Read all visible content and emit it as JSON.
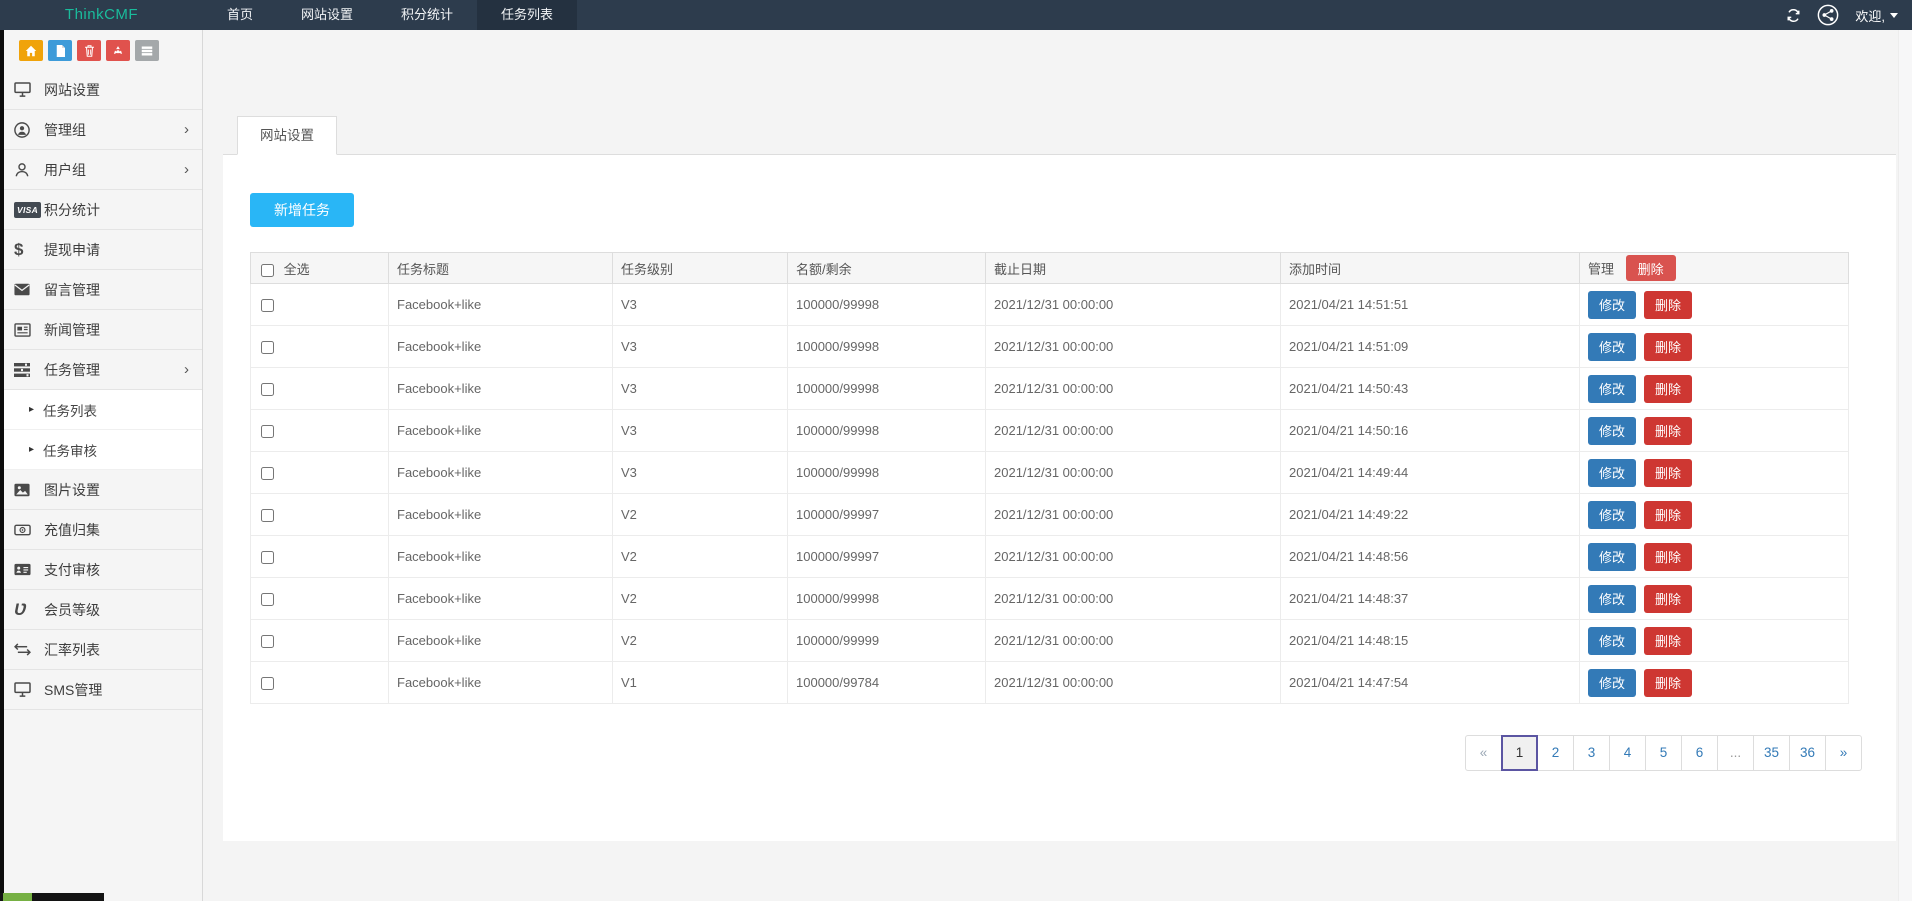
{
  "navbar": {
    "brand": "ThinkCMF",
    "items": [
      {
        "label": "首页",
        "active": false
      },
      {
        "label": "网站设置",
        "active": false
      },
      {
        "label": "积分统计",
        "active": false
      },
      {
        "label": "任务列表",
        "active": true
      }
    ],
    "welcome": "欢迎,"
  },
  "sidebar": {
    "quick_icons": [
      "home",
      "file",
      "trash",
      "recycle",
      "list"
    ],
    "items": [
      {
        "label": "网站设置"
      },
      {
        "label": "管理组"
      },
      {
        "label": "用户组"
      },
      {
        "label": "积分统计"
      },
      {
        "label": "提现申请"
      },
      {
        "label": "留言管理"
      },
      {
        "label": "新闻管理"
      },
      {
        "label": "任务管理"
      },
      {
        "label": "任务列表"
      },
      {
        "label": "任务审核"
      },
      {
        "label": "图片设置"
      },
      {
        "label": "充值归集"
      },
      {
        "label": "支付审核"
      },
      {
        "label": "会员等级"
      },
      {
        "label": "汇率列表"
      },
      {
        "label": "SMS管理"
      }
    ]
  },
  "glyphs": {
    "visa": "VISA",
    "dollar": "$",
    "vine": "Ʋ",
    "chevron": "›",
    "sub_arrow": "▸"
  },
  "main": {
    "tab": "网站设置",
    "add_button": "新增任务",
    "table": {
      "headers": {
        "select_all": "全选",
        "title": "任务标题",
        "level": "任务级别",
        "quota": "名额/剩余",
        "deadline": "截止日期",
        "added": "添加时间",
        "manage": "管理",
        "delete": "删除"
      },
      "edit_label": "修改",
      "delete_label": "删除",
      "rows": [
        {
          "title": "Facebook+like",
          "level": "V3",
          "quota": "100000/99998",
          "deadline": "2021/12/31 00:00:00",
          "added": "2021/04/21 14:51:51"
        },
        {
          "title": "Facebook+like",
          "level": "V3",
          "quota": "100000/99998",
          "deadline": "2021/12/31 00:00:00",
          "added": "2021/04/21 14:51:09"
        },
        {
          "title": "Facebook+like",
          "level": "V3",
          "quota": "100000/99998",
          "deadline": "2021/12/31 00:00:00",
          "added": "2021/04/21 14:50:43"
        },
        {
          "title": "Facebook+like",
          "level": "V3",
          "quota": "100000/99998",
          "deadline": "2021/12/31 00:00:00",
          "added": "2021/04/21 14:50:16"
        },
        {
          "title": "Facebook+like",
          "level": "V3",
          "quota": "100000/99998",
          "deadline": "2021/12/31 00:00:00",
          "added": "2021/04/21 14:49:44"
        },
        {
          "title": "Facebook+like",
          "level": "V2",
          "quota": "100000/99997",
          "deadline": "2021/12/31 00:00:00",
          "added": "2021/04/21 14:49:22"
        },
        {
          "title": "Facebook+like",
          "level": "V2",
          "quota": "100000/99997",
          "deadline": "2021/12/31 00:00:00",
          "added": "2021/04/21 14:48:56"
        },
        {
          "title": "Facebook+like",
          "level": "V2",
          "quota": "100000/99998",
          "deadline": "2021/12/31 00:00:00",
          "added": "2021/04/21 14:48:37"
        },
        {
          "title": "Facebook+like",
          "level": "V2",
          "quota": "100000/99999",
          "deadline": "2021/12/31 00:00:00",
          "added": "2021/04/21 14:48:15"
        },
        {
          "title": "Facebook+like",
          "level": "V1",
          "quota": "100000/99784",
          "deadline": "2021/12/31 00:00:00",
          "added": "2021/04/21 14:47:54"
        }
      ]
    },
    "pagination": {
      "items": [
        "«",
        "1",
        "2",
        "3",
        "4",
        "5",
        "6",
        "...",
        "35",
        "36",
        "»"
      ]
    }
  },
  "colors": {
    "brand_teal": "#1abc9c",
    "navbar_bg": "#2d3c4d",
    "add_button_blue": "#29b6f6",
    "edit_blue": "#337ab7",
    "delete_red": "#ce3732",
    "header_delete_red": "#d9534f",
    "quick_orange": "#f0a30a",
    "quick_blue": "#3d9bd9",
    "quick_red": "#e0524d",
    "quick_gray": "#a4a8aa"
  }
}
